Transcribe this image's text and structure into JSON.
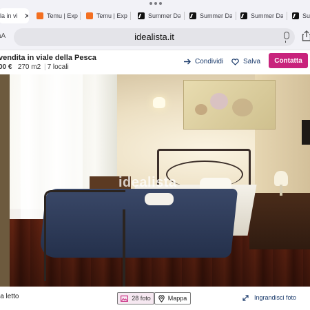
{
  "tabs": [
    {
      "title": "lla in vi",
      "favicon": "idealista-icon",
      "active": true
    },
    {
      "title": "Temu | Explo",
      "favicon": "temu-icon",
      "active": false
    },
    {
      "title": "Temu | Explo",
      "favicon": "temu-icon",
      "active": false
    },
    {
      "title": "Summer Day",
      "favicon": "summer-icon",
      "active": false
    },
    {
      "title": "Summer Day",
      "favicon": "summer-icon",
      "active": false
    },
    {
      "title": "Summer Day",
      "favicon": "summer-icon",
      "active": false
    },
    {
      "title": "Summe",
      "favicon": "summer-icon",
      "active": false
    }
  ],
  "tab_close_glyph": "✕",
  "address_bar": {
    "url": "idealista.it",
    "left_icon_text": "aA"
  },
  "listing": {
    "title": "vendita in viale della Pesca",
    "price": "00 €",
    "area": "270 m2",
    "rooms": "7 locali",
    "separator": "|"
  },
  "actions": {
    "share_label": "Condividi",
    "save_label": "Salva",
    "contact_label": "Contatta"
  },
  "photo": {
    "watermark": "idealista",
    "caption": "la letto"
  },
  "gallery": {
    "photos_label": "28 foto",
    "map_label": "Mappa",
    "enlarge_label": "Ingrandisci foto"
  },
  "colors": {
    "accent": "#c8237c",
    "link": "#1a3a6b",
    "tab_bg": "#f2f2f7",
    "photos_button_bg": "#f6e8f1"
  }
}
